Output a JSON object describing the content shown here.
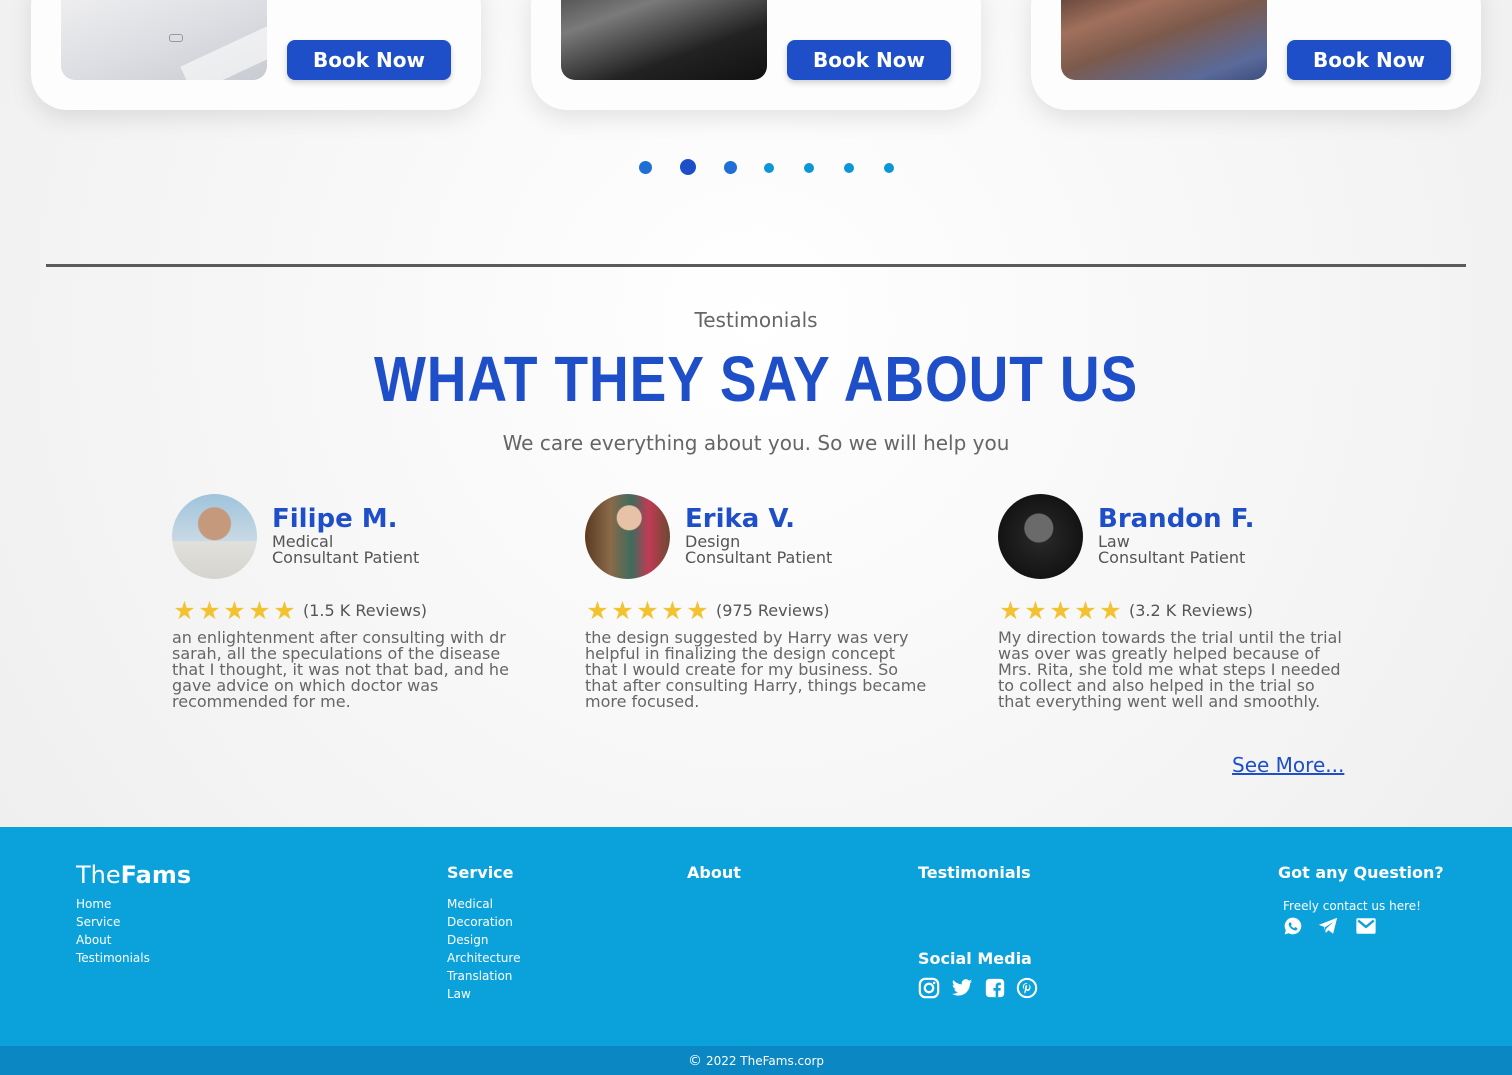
{
  "cards": [
    {
      "button_label": "Book Now"
    },
    {
      "button_label": "Book Now"
    },
    {
      "button_label": "Book Now"
    }
  ],
  "carousel": {
    "dot_count": 7,
    "active_index": 1
  },
  "testimonials": {
    "eyebrow": "Testimonials",
    "heading": "WHAT THEY SAY ABOUT US",
    "subheading": "We care everything about you. So we will help you",
    "items": [
      {
        "name": "Filipe M.",
        "role_line1": "Medical",
        "role_line2": "Consultant Patient",
        "stars": 5,
        "reviews": "(1.5 K Reviews)",
        "text": "an enlightenment after consulting with dr sarah, all the speculations of the disease that I thought, it was not that bad, and he gave advice on which doctor was recommended for me."
      },
      {
        "name": "Erika V.",
        "role_line1": "Design",
        "role_line2": "Consultant Patient",
        "stars": 5,
        "reviews": "(975 Reviews)",
        "text": "the design suggested by Harry was very helpful in finalizing the design concept that I would create for my business. So that after consulting Harry, things became more focused."
      },
      {
        "name": "Brandon F.",
        "role_line1": "Law",
        "role_line2": "Consultant Patient",
        "stars": 5,
        "reviews": "(3.2 K Reviews)",
        "text": "My direction towards the trial until the trial was over was greatly helped because of Mrs. Rita, she told me what steps I needed to collect and also helped in the trial so that everything went well and smoothly."
      }
    ],
    "see_more": "See More..."
  },
  "footer": {
    "brand_part1": "The",
    "brand_part2": "Fams",
    "nav": [
      "Home",
      "Service",
      "About",
      "Testimonials"
    ],
    "service_title": "Service",
    "service_links": [
      "Medical",
      "Decoration",
      "Design",
      "Architecture",
      "Translation",
      "Law"
    ],
    "about_title": "About",
    "testimonials_title": "Testimonials",
    "social_title": "Social Media",
    "social_icons": [
      "instagram-icon",
      "twitter-icon",
      "facebook-icon",
      "pinterest-icon"
    ],
    "question_title": "Got any Question?",
    "contact_text": "Freely contact us here!",
    "contact_icons": [
      "whatsapp-icon",
      "telegram-icon",
      "mail-icon"
    ],
    "copyright": "2022 TheFams.corp"
  },
  "colors": {
    "primary": "#1f4fc8",
    "footer": "#0ba2dc",
    "footer_bottom": "#0b88c3",
    "star": "#f2c230"
  }
}
